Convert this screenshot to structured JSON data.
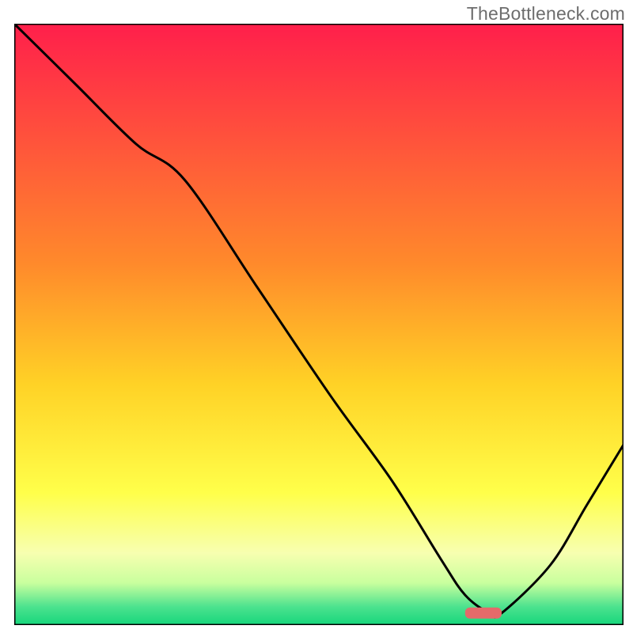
{
  "watermark": "TheBottleneck.com",
  "chart_data": {
    "type": "line",
    "title": "",
    "xlabel": "",
    "ylabel": "",
    "xlim": [
      0,
      100
    ],
    "ylim": [
      0,
      100
    ],
    "grid": false,
    "legend": false,
    "background": {
      "type": "vertical-gradient",
      "stops": [
        {
          "offset": 0,
          "color": "#ff1f4b"
        },
        {
          "offset": 40,
          "color": "#ff8a2b"
        },
        {
          "offset": 60,
          "color": "#ffd226"
        },
        {
          "offset": 78,
          "color": "#ffff4a"
        },
        {
          "offset": 88,
          "color": "#f7ffb0"
        },
        {
          "offset": 93,
          "color": "#c9ff9e"
        },
        {
          "offset": 97,
          "color": "#4be28e"
        },
        {
          "offset": 100,
          "color": "#16d67b"
        }
      ]
    },
    "series": [
      {
        "name": "bottleneck-curve",
        "x": [
          0,
          10,
          20,
          28,
          40,
          52,
          62,
          70,
          74,
          78,
          80,
          88,
          94,
          100
        ],
        "y": [
          100,
          90,
          80,
          74,
          56,
          38,
          24,
          11,
          5,
          2,
          2,
          10,
          20,
          30
        ]
      }
    ],
    "marker": {
      "name": "optimal-range",
      "x_start": 74,
      "x_end": 80,
      "y": 2,
      "color": "#e46a6a"
    }
  }
}
